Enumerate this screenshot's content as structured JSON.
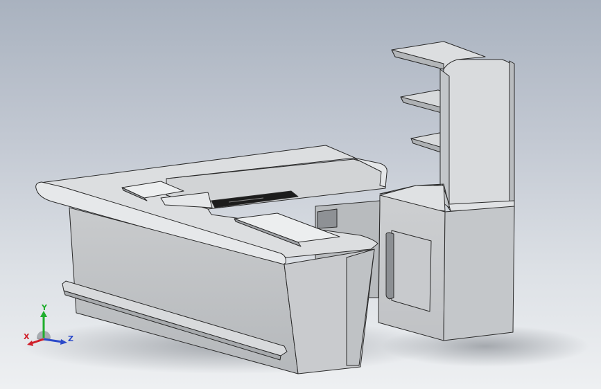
{
  "viewport": {
    "background_top": "#a9b2bf",
    "background_bottom": "#eef0f2",
    "model_fill": "#d4d6d8",
    "model_shade": "#9fa2a6",
    "model_edge": "#2a2a2a"
  },
  "triad": {
    "x_label": "X",
    "y_label": "Y",
    "z_label": "Z",
    "x_color": "#d0202a",
    "y_color": "#1fae2c",
    "z_color": "#2b49c9"
  }
}
